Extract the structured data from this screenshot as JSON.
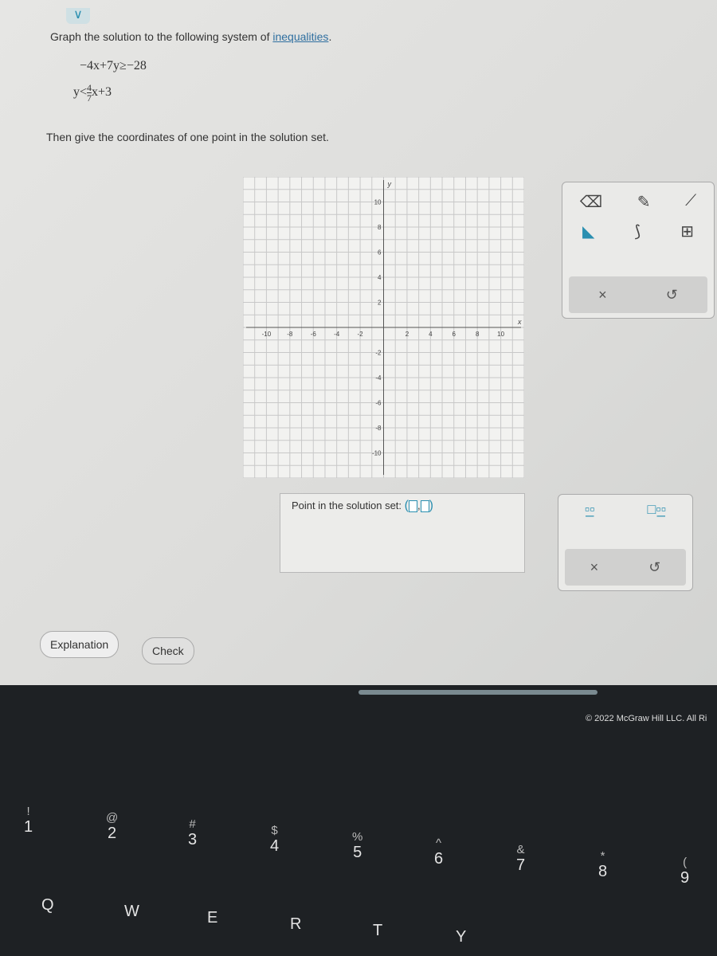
{
  "problem": {
    "prompt": "Graph the solution to the following system of",
    "link": "inequalities",
    "period": ".",
    "ineq1": "−4x+7y≥−28",
    "ineq2_left": "y<",
    "ineq2_num": "4",
    "ineq2_den": "7",
    "ineq2_right": "x+3",
    "then": "Then give the coordinates of one point in the solution set."
  },
  "graph": {
    "x_ticks": [
      "-10",
      "-8",
      "-6",
      "-4",
      "-2",
      "2",
      "4",
      "6",
      "8",
      "10"
    ],
    "y_ticks": [
      "10",
      "8",
      "6",
      "4",
      "2",
      "-2",
      "-4",
      "-6",
      "-8",
      "-10"
    ],
    "x_label": "x",
    "y_label": "y",
    "range": [
      -12,
      12
    ]
  },
  "answer": {
    "label": "Point in the solution set:",
    "open": "(",
    ",": ",",
    "close": ")"
  },
  "tools": {
    "icons": [
      "eraser-icon",
      "pencil-icon",
      "line-icon",
      "fill-region-icon",
      "curve-icon",
      "grid-icon"
    ],
    "clear": "×",
    "undo": "↺"
  },
  "fraction_tools": {
    "clear": "×",
    "undo": "↺"
  },
  "buttons": {
    "explanation": "Explanation",
    "check": "Check"
  },
  "footer": {
    "copyright": "© 2022 McGraw Hill LLC. All Ri"
  },
  "keyboard": [
    {
      "main": "1",
      "shift": "!"
    },
    {
      "main": "2",
      "shift": "@"
    },
    {
      "main": "3",
      "shift": "#"
    },
    {
      "main": "4",
      "shift": "$"
    },
    {
      "main": "5",
      "shift": "%"
    },
    {
      "main": "6",
      "shift": "^"
    },
    {
      "main": "7",
      "shift": "&"
    },
    {
      "main": "8",
      "shift": "*"
    },
    {
      "main": "9",
      "shift": "("
    }
  ],
  "letters": [
    "Q",
    "W",
    "E",
    "R",
    "T",
    "Y"
  ],
  "colors": {
    "accent": "#2a8fb0"
  }
}
